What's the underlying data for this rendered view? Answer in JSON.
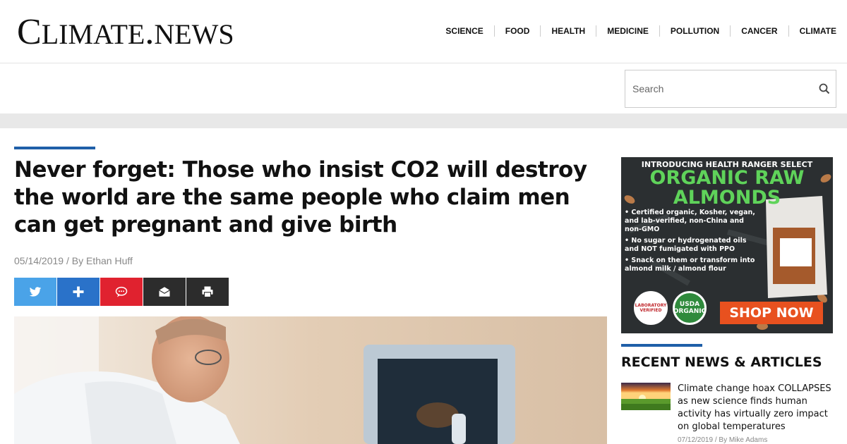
{
  "site": {
    "logo_big_c": "C",
    "logo_rest_1": "LIMATE",
    "logo_dot": ".",
    "logo_rest_2": "NEWS"
  },
  "nav": [
    "SCIENCE",
    "FOOD",
    "HEALTH",
    "MEDICINE",
    "POLLUTION",
    "CANCER",
    "CLIMATE"
  ],
  "search": {
    "placeholder": "Search"
  },
  "article": {
    "headline": "Never forget: Those who insist CO2 will destroy the world are the same people who claim men can get pregnant and give birth",
    "date": "05/14/2019",
    "separator": "/",
    "author": "By Ethan Huff"
  },
  "share_buttons": [
    {
      "name": "twitter",
      "icon": "twitter-icon",
      "color": "#4aa3e8"
    },
    {
      "name": "plus",
      "icon": "plus-icon",
      "color": "#2a72c9"
    },
    {
      "name": "comment",
      "icon": "comment-icon",
      "color": "#e0222f"
    },
    {
      "name": "email",
      "icon": "email-icon",
      "color": "#2c2c2c"
    },
    {
      "name": "print",
      "icon": "print-icon",
      "color": "#2c2c2c"
    }
  ],
  "ad": {
    "intro": "INTRODUCING HEALTH RANGER SELECT",
    "title_line1": "ORGANIC RAW",
    "title_line2": "ALMONDS",
    "bullets": [
      "• Certified organic, Kosher, vegan, and lab-verified, non-China and non-GMO",
      "• No sugar or hydrogenated oils and NOT fumigated with PPO",
      "• Snack on them or transform into almond milk / almond flour"
    ],
    "badge_lab": "LABORATORY VERIFIED",
    "badge_usda": "USDA ORGANIC",
    "cta": "SHOP NOW"
  },
  "sidebar": {
    "title": "RECENT NEWS & ARTICLES",
    "items": [
      {
        "title": "Climate change hoax COLLAPSES as new science finds human activity has virtually zero impact on global temperatures",
        "date": "07/12/2019",
        "separator": "/",
        "author": "By Mike Adams"
      }
    ]
  },
  "colors": {
    "accent": "#1f5fa8",
    "shop_button": "#e8511f",
    "ad_green": "#5fd35a"
  }
}
